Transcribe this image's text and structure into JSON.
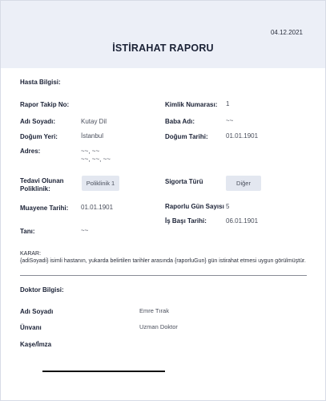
{
  "header": {
    "date": "04.12.2021",
    "title": "İSTİRAHAT RAPORU"
  },
  "patient": {
    "section_title": "Hasta Bilgisi:",
    "report_no_label": "Rapor Takip No:",
    "report_no_value": "",
    "id_label": "Kimlik Numarası:",
    "id_value": "1",
    "name_label": "Adı Soyadı:",
    "name_value": "Kutay Dil",
    "father_label": "Baba Adı:",
    "father_value": "~~",
    "birthplace_label": "Doğum Yeri:",
    "birthplace_value": "İstanbul",
    "birthdate_label": "Doğum Tarihi:",
    "birthdate_value": "01.01.1901",
    "address_label": "Adres:",
    "address_value": "~~, ~~\n~~, ~~, ~~",
    "clinic_label": "Tedavi Olunan Poliklinik:",
    "clinic_value": "Poliklinik 1",
    "insurance_label": "Sigorta Türü",
    "insurance_value": "Diğer",
    "exam_date_label": "Muayene Tarihi:",
    "exam_date_value": "01.01.1901",
    "report_days_label": "Raporlu Gün Sayısı",
    "report_days_value": "5",
    "return_date_label": "İş Başı Tarihi:",
    "return_date_value": "06.01.1901",
    "diagnosis_label": "Tanı:",
    "diagnosis_value": "~~"
  },
  "decision": {
    "label": "KARAR:",
    "text": "{adiSoyadi} isimli hastanın, yukarda belirtilen tarihler arasında {raporluGun} gün istirahat etmesi uygun görülmüştür."
  },
  "doctor": {
    "section_title": "Doktor Bilgisi:",
    "name_label": "Adı Soyadı",
    "name_value": "Emre Tırak",
    "title_label": "Ünvanı",
    "title_value": "Uzman Doktor",
    "stamp_label": "Kaşe/İmza"
  }
}
